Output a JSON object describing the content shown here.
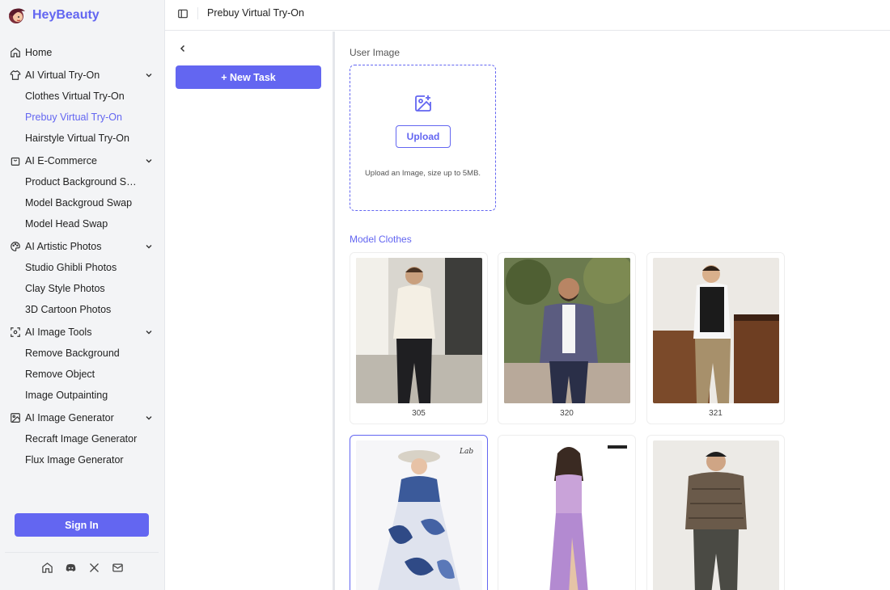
{
  "brand": {
    "name": "HeyBeauty"
  },
  "sidebar": {
    "groups": [
      {
        "label": "Home",
        "icon": "home-icon",
        "items": []
      },
      {
        "label": "AI Virtual Try-On",
        "icon": "shirt-icon",
        "items": [
          "Clothes Virtual Try-On",
          "Prebuy Virtual Try-On",
          "Hairstyle Virtual Try-On"
        ]
      },
      {
        "label": "AI E-Commerce",
        "icon": "shopping-bag-icon",
        "items": [
          "Product Background Sw...",
          "Model Backgroud Swap",
          "Model Head Swap"
        ]
      },
      {
        "label": "AI Artistic Photos",
        "icon": "palette-icon",
        "items": [
          "Studio Ghibli Photos",
          "Clay Style Photos",
          "3D Cartoon Photos"
        ]
      },
      {
        "label": "AI Image Tools",
        "icon": "scan-icon",
        "items": [
          "Remove Background",
          "Remove Object",
          "Image Outpainting"
        ]
      },
      {
        "label": "AI Image Generator",
        "icon": "image-icon",
        "items": [
          "Recraft Image Generator",
          "Flux Image Generator"
        ]
      }
    ],
    "active_item": "Prebuy Virtual Try-On",
    "sign_in_label": "Sign In",
    "social_icons": [
      "home-icon",
      "discord-icon",
      "x-icon",
      "mail-icon"
    ]
  },
  "topbar": {
    "breadcrumb": "Prebuy Virtual Try-On"
  },
  "task_panel": {
    "new_task_label": "+ New Task"
  },
  "main": {
    "user_image_label": "User Image",
    "upload_label": "Upload",
    "upload_hint": "Upload an Image, size up to 5MB.",
    "model_clothes_label": "Model Clothes",
    "clothes": [
      {
        "label": "305",
        "selected": false
      },
      {
        "label": "320",
        "selected": false
      },
      {
        "label": "321",
        "selected": false
      },
      {
        "label": "",
        "selected": true
      },
      {
        "label": "",
        "selected": false
      },
      {
        "label": "",
        "selected": false
      }
    ]
  },
  "colors": {
    "accent": "#6366f1",
    "sidebar_bg": "#f3f4f6",
    "border": "#e5e7eb"
  }
}
